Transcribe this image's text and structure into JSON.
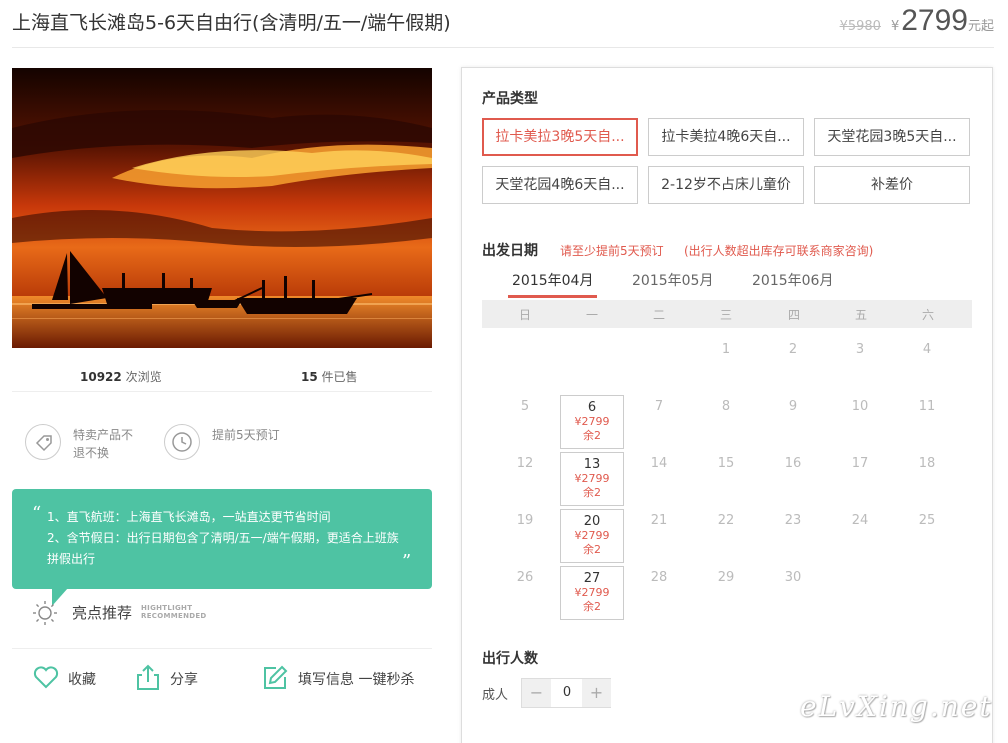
{
  "header": {
    "title": "上海直飞长滩岛5-6天自由行(含清明/五一/端午假期)",
    "old_price": "¥5980",
    "currency": "¥",
    "price": "2799",
    "price_unit": "元起"
  },
  "stats": {
    "views_count": "10922",
    "views_label": "次浏览",
    "sold_count": "15",
    "sold_label": "件已售"
  },
  "features": [
    {
      "icon": "tag-icon",
      "text": "特卖产品不退不换"
    },
    {
      "icon": "clock-icon",
      "text": "提前5天预订"
    }
  ],
  "highlights": {
    "lines": [
      "1、直飞航班：上海直飞长滩岛，一站直达更节省时间",
      "2、含节假日：出行日期包含了清明/五一/端午假期，更适合上班族",
      "拼假出行"
    ],
    "title": "亮点推荐",
    "title_en_1": "HIGHTLIGHT",
    "title_en_2": "RECOMMENDED"
  },
  "actions": {
    "favorite": "收藏",
    "share": "分享",
    "fill_info": "填写信息 一键秒杀"
  },
  "booking": {
    "product_type_label": "产品类型",
    "product_types": [
      "拉卡美拉3晚5天自...",
      "拉卡美拉4晚6天自...",
      "天堂花园3晚5天自...",
      "天堂花园4晚6天自...",
      "2-12岁不占床儿童价",
      "补差价"
    ],
    "date_label": "出发日期",
    "date_note_1": "请至少提前5天预订",
    "date_note_2": "(出行人数超出库存可联系商家咨询)",
    "months": [
      "2015年04月",
      "2015年05月",
      "2015年06月"
    ],
    "weekdays": [
      "日",
      "一",
      "二",
      "三",
      "四",
      "五",
      "六"
    ],
    "calendar": {
      "row1": [
        "1",
        "2",
        "3",
        "4"
      ],
      "row2": [
        "5",
        "6",
        "7",
        "8",
        "9",
        "10",
        "11"
      ],
      "row3": [
        "12",
        "13",
        "14",
        "15",
        "16",
        "17",
        "18"
      ],
      "row4": [
        "19",
        "20",
        "21",
        "22",
        "23",
        "24",
        "25"
      ],
      "row5": [
        "26",
        "27",
        "28",
        "29",
        "30"
      ],
      "avail_price": "¥2799",
      "avail_stock": "余2"
    },
    "pax_label": "出行人数",
    "adult_label": "成人",
    "adult_count": "0",
    "minus": "−",
    "plus": "+"
  },
  "watermark": "eLvXing.net",
  "colors": {
    "accent": "#e05a4e",
    "highlight_green": "#4ec3a3"
  }
}
